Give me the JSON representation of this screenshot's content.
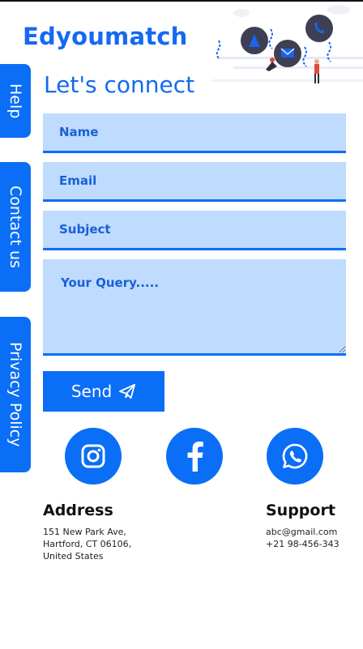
{
  "brand": {
    "name": "Edyoumatch"
  },
  "contact": {
    "heading": "Let's connect",
    "fields": {
      "name_placeholder": "Name",
      "email_placeholder": "Email",
      "subject_placeholder": "Subject",
      "query_placeholder": "Your Query....."
    },
    "send_label": "Send"
  },
  "side_tabs": {
    "help": "Help",
    "contact": "Contact us",
    "privacy": "Privacy Policy"
  },
  "social": [
    "instagram-icon",
    "facebook-icon",
    "whatsapp-icon"
  ],
  "footer": {
    "address_title": "Address",
    "address_lines": [
      "151 New Park Ave,",
      "Hartford, CT 06106,",
      "United States"
    ],
    "support_title": "Support",
    "support_email": "abc@gmail.com",
    "support_phone": "+21 98-456-343"
  },
  "colors": {
    "accent": "#0b6ef7",
    "brand_text": "#1469f0",
    "field_bg": "#bfdbfd"
  }
}
